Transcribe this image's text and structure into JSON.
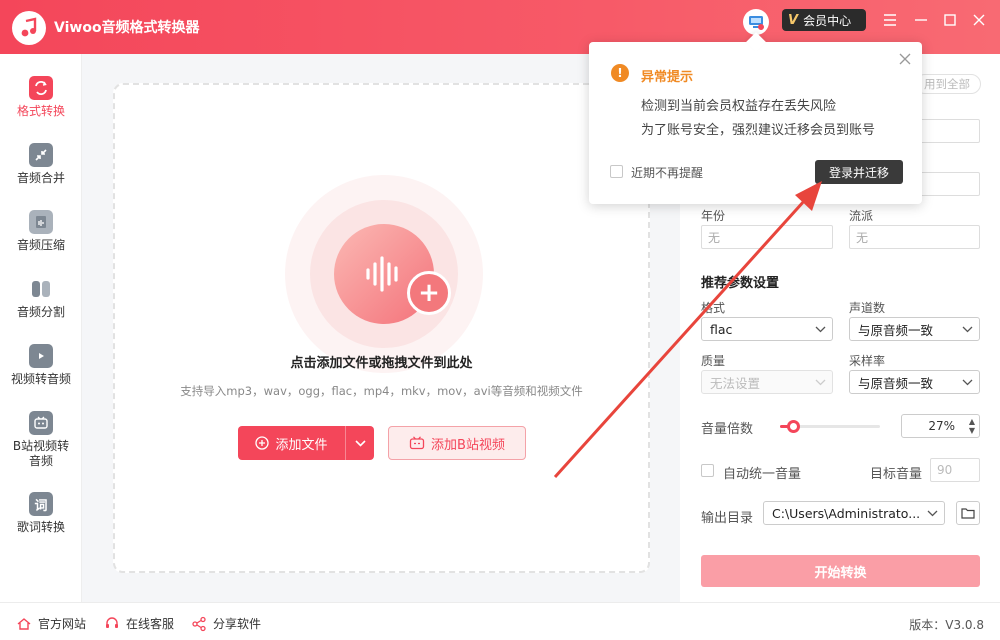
{
  "app": {
    "title": "Viwoo音频格式转换器",
    "vip_label": "会员中心",
    "vip_badge": "V"
  },
  "sidebar": {
    "items": [
      {
        "label": "格式转换",
        "icon": "format-convert-icon",
        "active": true
      },
      {
        "label": "音频合并",
        "icon": "merge-icon"
      },
      {
        "label": "音频压缩",
        "icon": "compress-icon"
      },
      {
        "label": "音频分割",
        "icon": "split-icon"
      },
      {
        "label": "视频转音频",
        "icon": "video-to-audio-icon"
      },
      {
        "label": "B站视频转音频",
        "label_line1": "B站视频转",
        "label_line2": "音频",
        "icon": "bilibili-icon"
      },
      {
        "label": "歌词转换",
        "icon": "lyrics-icon",
        "glyph": "词"
      }
    ]
  },
  "dropzone": {
    "title": "点击添加文件或拖拽文件到此处",
    "subtitle": "支持导入mp3，wav，ogg，flac，mp4，mkv，mov，avi等音频和视频文件",
    "add_file_label": "添加文件",
    "add_bili_label": "添加B站视频"
  },
  "popup": {
    "title": "异常提示",
    "line1": "检测到当前会员权益存在丢失风险",
    "line2": "为了账号安全，强烈建议迁移会员到账号",
    "dont_remind": "近期不再提醒",
    "action": "登录并迁移"
  },
  "right_panel": {
    "apply_all": "用到全部",
    "year_label": "年份",
    "year_value": "无",
    "genre_label": "流派",
    "genre_value": "无",
    "params_title": "推荐参数设置",
    "format_label": "格式",
    "format_value": "flac",
    "channels_label": "声道数",
    "channels_value": "与原音频一致",
    "quality_label": "质量",
    "quality_value": "无法设置",
    "samplerate_label": "采样率",
    "samplerate_value": "与原音频一致",
    "volume_label": "音量倍数",
    "volume_value": "27%",
    "volume_fraction": 0.13,
    "auto_volume_label": "自动统一音量",
    "target_volume_label": "目标音量",
    "target_volume_value": "90",
    "output_label": "输出目录",
    "output_value": "C:\\Users\\Administrato...",
    "start_label": "开始转换"
  },
  "bottom": {
    "website": "官方网站",
    "support": "在线客服",
    "share": "分享软件",
    "version": "版本：V3.0.8"
  },
  "colors": {
    "accent": "#f4465a",
    "warning": "#f08a24",
    "annotation_arrow": "#e8453c"
  }
}
